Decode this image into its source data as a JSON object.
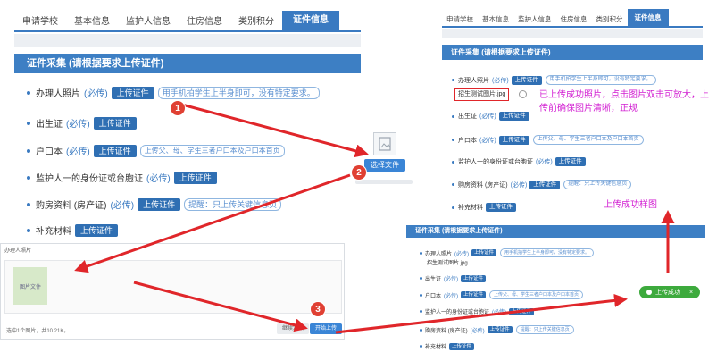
{
  "tabs": [
    "申请学校",
    "基本信息",
    "监护人信息",
    "住房信息",
    "类别积分",
    "证件信息"
  ],
  "section_title": "证件采集 (请根据要求上传证件)",
  "rows": [
    {
      "label": "办理人照片",
      "required": "(必传)",
      "button": "上传证件",
      "hint": "用手机拍学生上半身即可，没有特定要求。"
    },
    {
      "label": "出生证",
      "required": "(必传)",
      "button": "上传证件",
      "hint": ""
    },
    {
      "label": "户口本",
      "required": "(必传)",
      "button": "上传证件",
      "hint": "上传父、母、学生三者户口本及户口本首页"
    },
    {
      "label": "监护人一的身份证或台胞证",
      "required": "(必传)",
      "button": "上传证件",
      "hint": ""
    },
    {
      "label": "购房资料 (房产证)",
      "required": "(必传)",
      "button": "上传证件",
      "hint": "提醒：只上传关键信息页"
    },
    {
      "label": "补充材料",
      "required": "",
      "button": "上传证件",
      "hint": ""
    }
  ],
  "upload_file_name": "招生测试图片.jpg",
  "upload_note_line1": "已上传成功照片，点击图片双击可放大，上",
  "upload_note_line2": "传前确保图片清晰，正规",
  "success_label": "上传成功样图",
  "success_toast": "上传成功",
  "select_button": "选择文件",
  "dialog": {
    "title": "办理人照片",
    "thumb_label": "图片文件",
    "footer_status": "选中1个图片，共10.21K。",
    "continue_button": "继续添加",
    "start_button": "开始上传"
  },
  "badges": [
    "1",
    "2",
    "3"
  ],
  "colors": {
    "primary": "#3a7ac1",
    "arrow": "#e0262a",
    "note": "#d21ed2",
    "success": "#3daa3d"
  }
}
